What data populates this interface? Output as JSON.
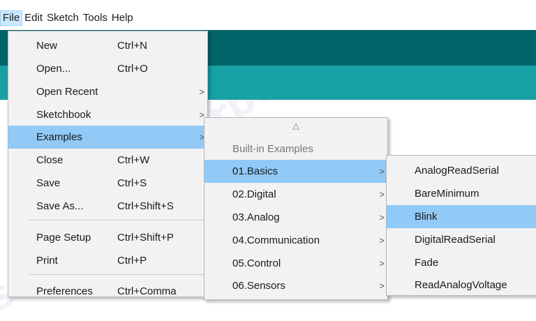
{
  "menubar": [
    "File",
    "Edit",
    "Sketch",
    "Tools",
    "Help"
  ],
  "file_menu": {
    "items": [
      {
        "label": "New",
        "shortcut": "Ctrl+N"
      },
      {
        "label": "Open...",
        "shortcut": "Ctrl+O"
      },
      {
        "label": "Open Recent",
        "shortcut": "",
        "submenu": true
      },
      {
        "label": "Sketchbook",
        "shortcut": "",
        "submenu": true
      },
      {
        "label": "Examples",
        "shortcut": "",
        "submenu": true
      },
      {
        "label": "Close",
        "shortcut": "Ctrl+W"
      },
      {
        "label": "Save",
        "shortcut": "Ctrl+S"
      },
      {
        "label": "Save As...",
        "shortcut": "Ctrl+Shift+S"
      },
      {
        "label": "Page Setup",
        "shortcut": "Ctrl+Shift+P"
      },
      {
        "label": "Print",
        "shortcut": "Ctrl+P"
      },
      {
        "label": "Preferences",
        "shortcut": "Ctrl+Comma"
      }
    ]
  },
  "examples_menu": {
    "scroll_up": "△",
    "header": "Built-in Examples",
    "items": [
      "01.Basics",
      "02.Digital",
      "03.Analog",
      "04.Communication",
      "05.Control",
      "06.Sensors"
    ]
  },
  "basics_menu": {
    "items": [
      "AnalogReadSerial",
      "BareMinimum",
      "Blink",
      "DigitalReadSerial",
      "Fade",
      "ReadAnalogVoltage"
    ]
  },
  "submenu_arrow": ">",
  "watermark_text": "superpc.ru",
  "colors": {
    "band_dark": "#006468",
    "band_teal": "#17a1a5",
    "highlight": "#91c9f7"
  }
}
